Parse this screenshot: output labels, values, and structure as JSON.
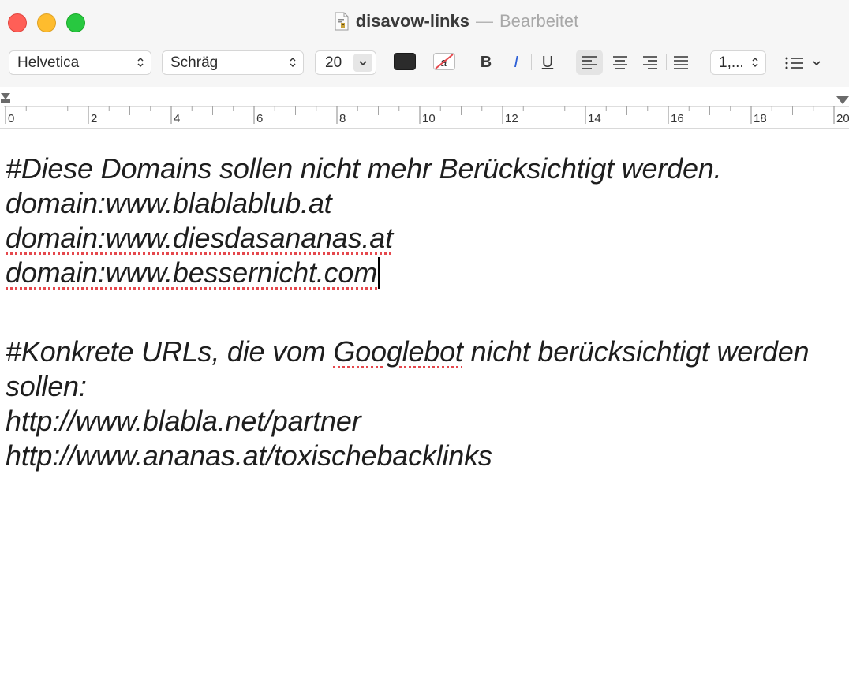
{
  "window": {
    "doc_name": "disavow-links",
    "separator": "—",
    "status": "Bearbeitet"
  },
  "toolbar": {
    "font_family": "Helvetica",
    "font_style": "Schräg",
    "font_size": "20",
    "bold_label": "B",
    "italic_label": "I",
    "underline_label": "U",
    "spacing_value": "1,...",
    "text_color": "#2b2b2b"
  },
  "ruler": {
    "labels": [
      "0",
      "2",
      "4",
      "6",
      "8",
      "10",
      "12",
      "14",
      "16",
      "18",
      "20"
    ]
  },
  "document": {
    "line1": "#Diese Domains sollen nicht mehr Berücksichtigt werden.",
    "line2_prefix": "domain:www.",
    "line2_word": "blablablub",
    "line2_suffix": ".at",
    "line3": "domain:www.diesdasananas.at",
    "line4": "domain:www.bessernicht.com",
    "line5_a": "#Konkrete URLs, die vom ",
    "line5_b": "Googlebot",
    "line5_c": " nicht berücksichtigt werden",
    "line6": "sollen:",
    "line7": "http://www.blabla.net/partner",
    "line8": "http://www.ananas.at/toxischebacklinks"
  }
}
